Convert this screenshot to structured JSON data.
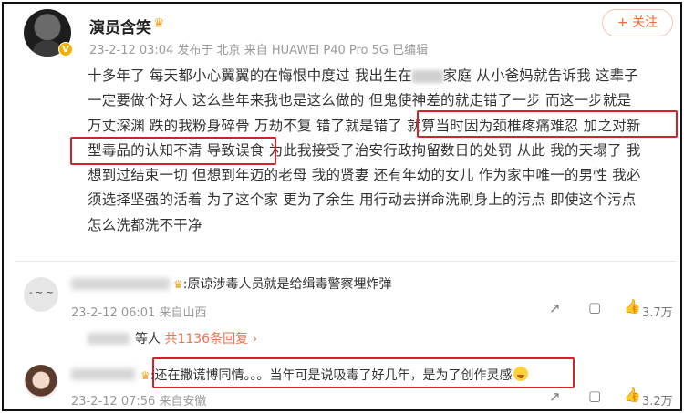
{
  "post": {
    "username": "演员含笑",
    "meta": "23-2-12 03:04  发布于 北京  来自 HUAWEI P40 Pro 5G 已编辑",
    "follow_label": "+ 关注",
    "lines": [
      [
        "十多年了 每天都小心翼翼的在悔恨中度过 我出生在",
        "家庭 从小爸妈就告诉我 这辈子"
      ],
      [
        "一定要做个好人 这么些年来我也是这么做的 但鬼使神差的就走错了一步 而这一步就是"
      ],
      [
        "万丈深渊 跌的我粉身碎骨 万劫不复 错了就是错了 就算当时因为颈椎疼痛难忍 加之对新"
      ],
      [
        "型毒品的认知不清 导致误食 为此我接受了治安行政拘留数日的处罚 从此 我的天塌了 我"
      ],
      [
        "想到过结束一切 但想到年迈的老母 我的贤妻 还有年幼的女儿 作为家中唯一的男性 我必"
      ],
      [
        "须选择坚强的活着 为了这个家 更为了余生 用行动去拼命洗刷身上的污点 即使这个污点"
      ],
      [
        "怎么洗都洗不干净"
      ]
    ]
  },
  "comments": [
    {
      "text": ":原谅涉毒人员就是给缉毒警察埋炸弹",
      "meta": "23-2-12 06:01  来自山西",
      "likes": "3.7万"
    },
    {
      "text": ":还在撒谎博同情。。。当年可是说吸毒了好几年，是为了创作灵感",
      "meta": "23-2-12 07:56  来自安徽",
      "likes": "3.2万"
    }
  ],
  "replies": {
    "prefix": "等人",
    "link": "共1136条回复",
    "arrow": "›"
  },
  "icons": {
    "share": "↗",
    "comment": "▢",
    "like": "👍"
  },
  "colors": {
    "highlight_border": "#d4222b",
    "link": "#eb7350",
    "follow": "#f06a2a"
  }
}
